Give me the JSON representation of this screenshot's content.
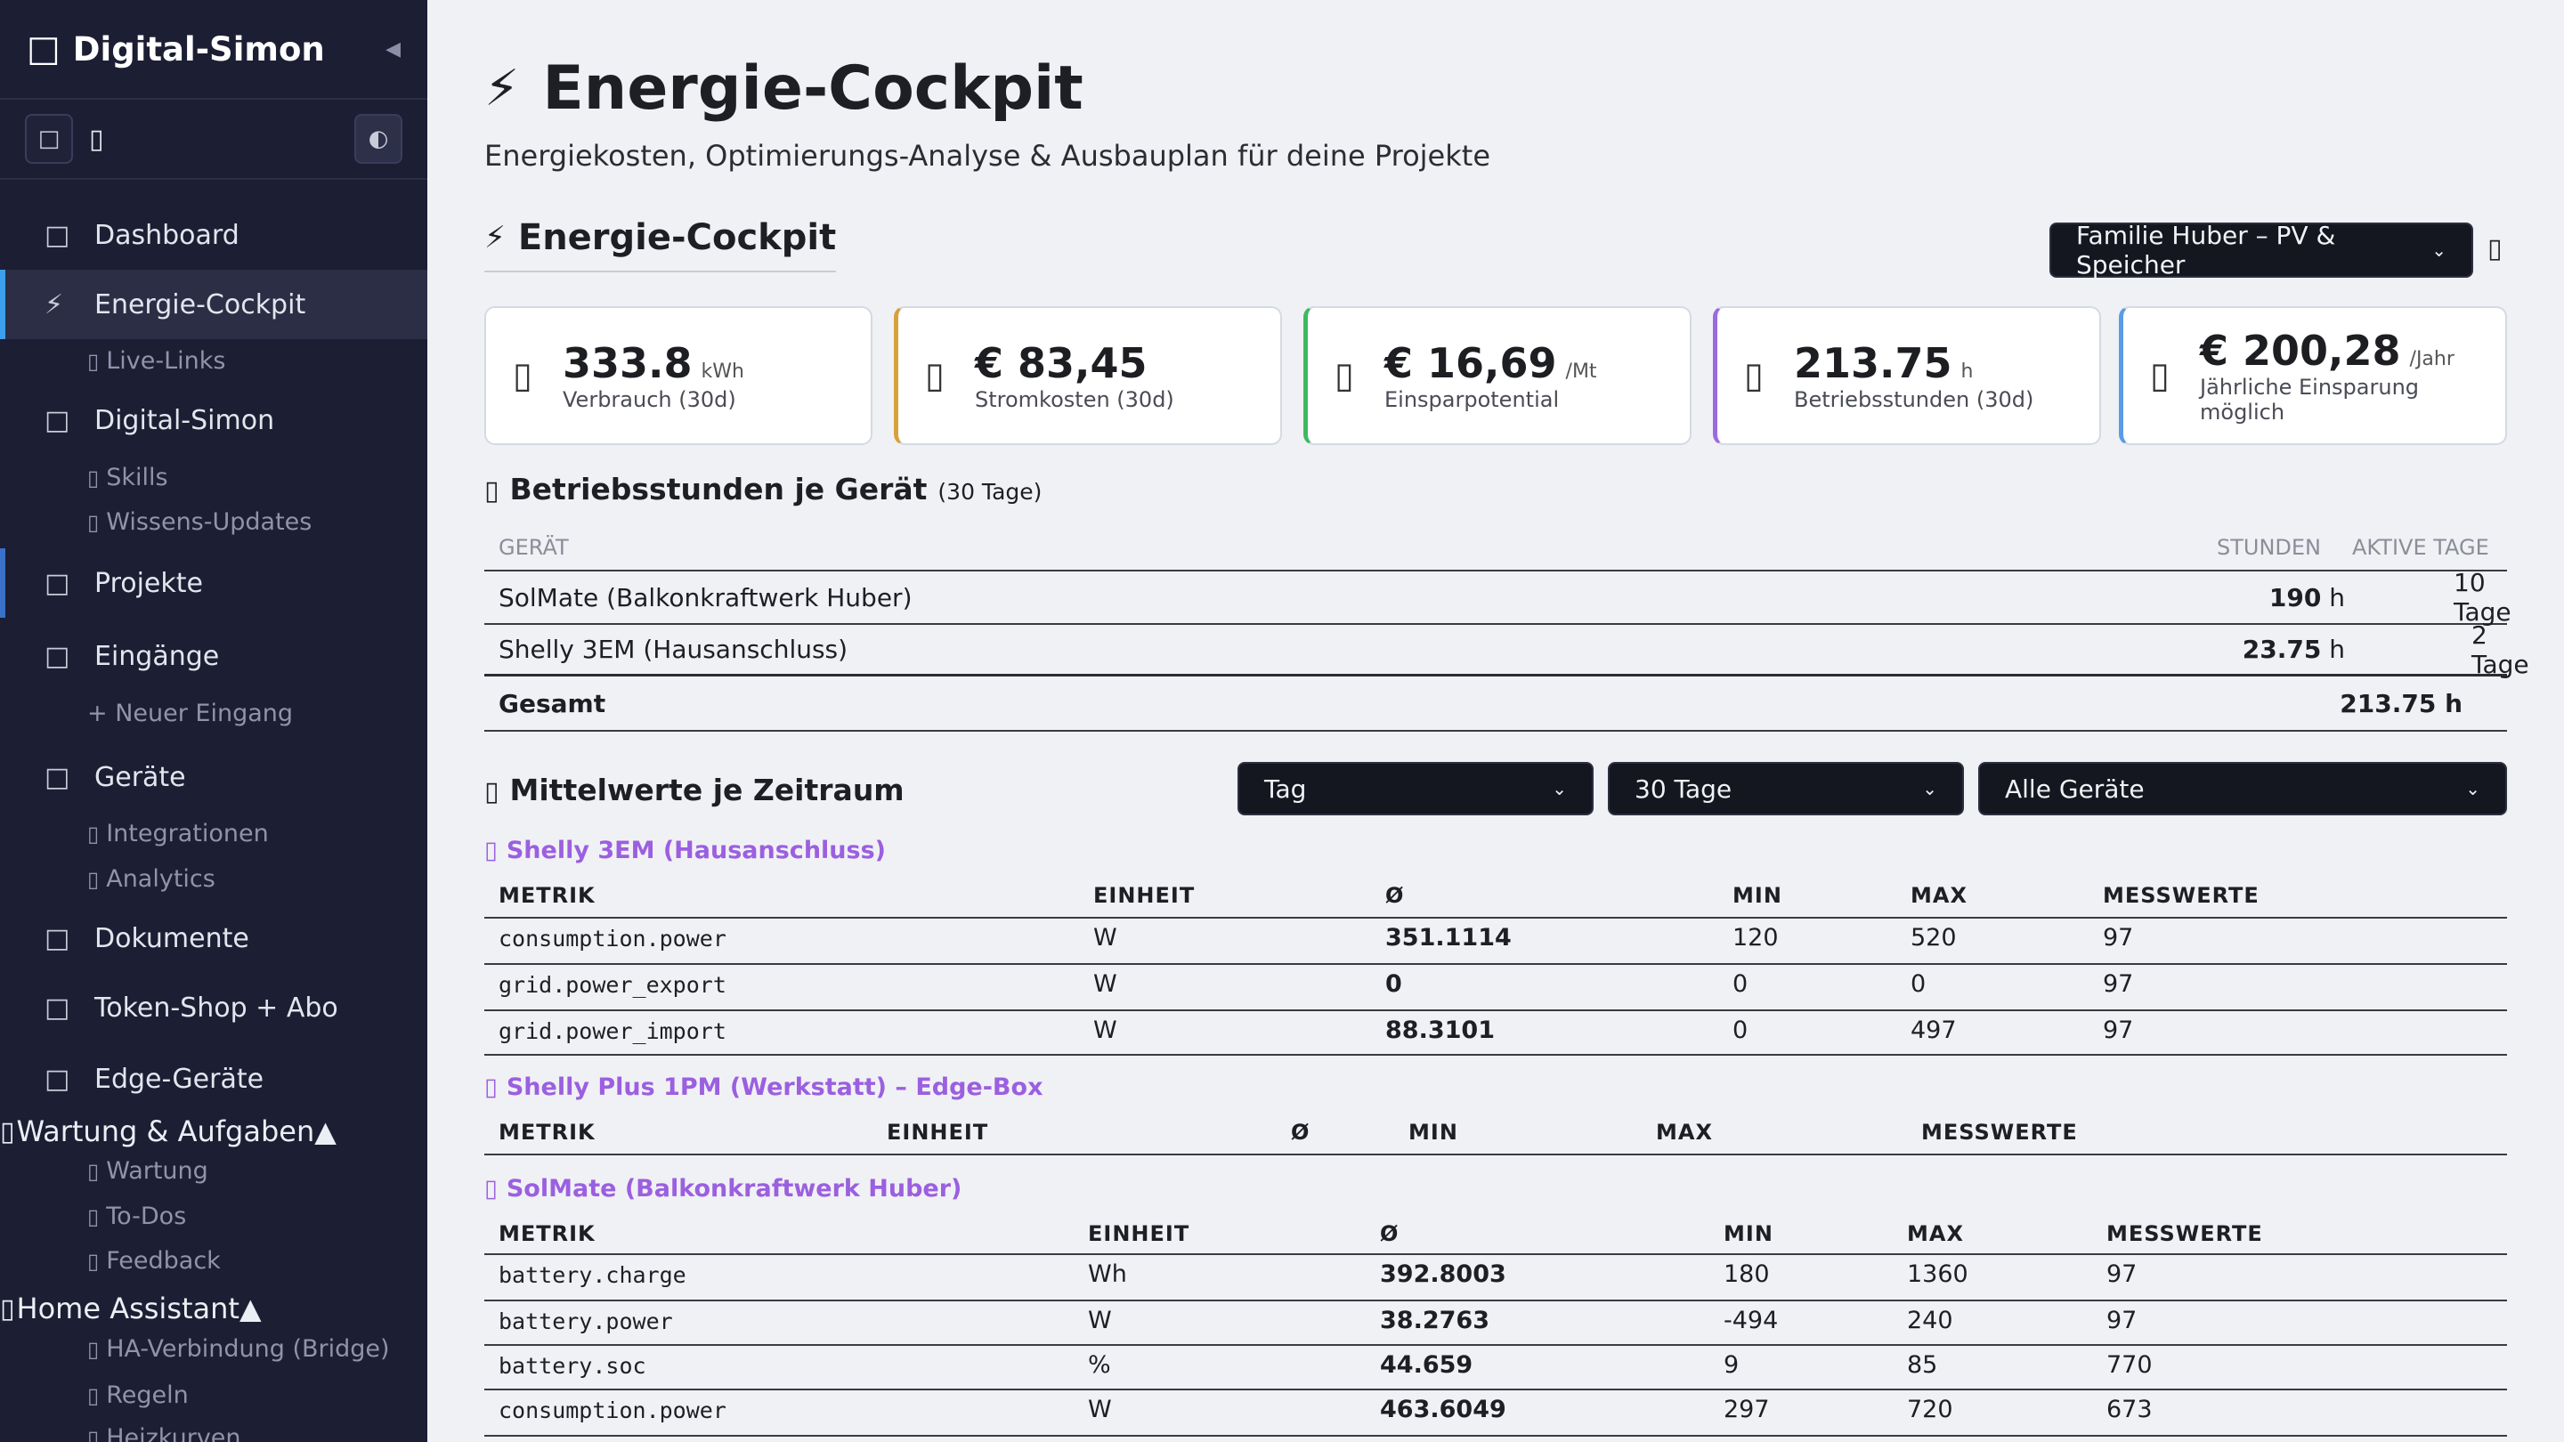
{
  "sidebar": {
    "brand_icon": "lightbulb-icon",
    "brand": "Digital-Simon",
    "collapse": "◀",
    "tool_icon_1": "home-icon",
    "tool_icon_2": "phone-icon",
    "tool_icon_3": "◐",
    "items": [
      {
        "icon": "",
        "label": "Dashboard"
      },
      {
        "icon": "⚡",
        "label": "Energie-Cockpit"
      },
      {
        "icon": "",
        "label": "Live-Links"
      },
      {
        "icon": "",
        "label": "Digital-Simon"
      },
      {
        "icon": "",
        "label": "Skills"
      },
      {
        "icon": "",
        "label": "Wissens-Updates"
      },
      {
        "icon": "",
        "label": "Projekte"
      },
      {
        "icon": "",
        "label": "Eingänge"
      },
      {
        "icon": "",
        "label": "+ Neuer Eingang"
      },
      {
        "icon": "",
        "label": "Geräte"
      },
      {
        "icon": "",
        "label": "Integrationen"
      },
      {
        "icon": "",
        "label": "Analytics"
      },
      {
        "icon": "",
        "label": "Dokumente"
      },
      {
        "icon": "",
        "label": "Token-Shop + Abo"
      },
      {
        "icon": "",
        "label": "Edge-Geräte"
      },
      {
        "icon": "",
        "label": "Wartung & Aufgaben▲"
      },
      {
        "icon": "",
        "label": "Wartung"
      },
      {
        "icon": "",
        "label": "To-Dos"
      },
      {
        "icon": "",
        "label": "Feedback"
      },
      {
        "icon": "",
        "label": "Home Assistant▲"
      },
      {
        "icon": "",
        "label": "HA-Verbindung (Bridge)"
      },
      {
        "icon": "",
        "label": "Regeln"
      },
      {
        "icon": "",
        "label": "Heizkurven"
      }
    ]
  },
  "header": {
    "title_icon": "⚡",
    "title": "Energie-Cockpit",
    "subtitle": "Energiekosten, Optimierungs-Analyse & Ausbauplan für deine Projekte"
  },
  "section": {
    "icon": "⚡",
    "title": "Energie-Cockpit",
    "project_select": "Familie Huber – PV & Speicher",
    "extra_button_icon": "phone-icon"
  },
  "kpis": [
    {
      "value": "333.8",
      "unit": "kWh",
      "label": "Verbrauch (30d)",
      "accent": "#d6d9e2"
    },
    {
      "value": "€ 83,45",
      "unit": "",
      "label": "Stromkosten (30d)",
      "accent": "#d6a23c"
    },
    {
      "value": "€ 16,69",
      "unit": "/Mt",
      "label": "Einsparpotential",
      "accent": "#3dba5f"
    },
    {
      "value": "213.75",
      "unit": "h",
      "label": "Betriebsstunden (30d)",
      "accent": "#9b6ae0"
    },
    {
      "value": "€ 200,28",
      "unit": "/Jahr",
      "label": "Jährliche Einsparung möglich",
      "accent": "#5a9be6"
    }
  ],
  "hours": {
    "title": "Betriebsstunden je Gerät",
    "period": "(30 Tage)",
    "columns": [
      "GERÄT",
      "STUNDEN",
      "AKTIVE TAGE"
    ],
    "rows": [
      {
        "device": "SolMate (Balkonkraftwerk Huber)",
        "hours": "190",
        "unit": "h",
        "days": "10 Tage"
      },
      {
        "device": "Shelly 3EM (Hausanschluss)",
        "hours": "23.75",
        "unit": "h",
        "days": "2 Tage"
      }
    ],
    "total_label": "Gesamt",
    "total_value": "213.75 h"
  },
  "averages": {
    "title": "Mittelwerte je Zeitraum",
    "select_interval": "Tag",
    "select_range": "30 Tage",
    "select_device": "Alle Geräte",
    "columns": [
      "METRIK",
      "EINHEIT",
      "Ø",
      "MIN",
      "MAX",
      "MESSWERTE"
    ],
    "devices": [
      {
        "title": "Shelly 3EM (Hausanschluss)",
        "rows": [
          [
            "consumption.power",
            "W",
            "351.1114",
            "120",
            "520",
            "97"
          ],
          [
            "grid.power_export",
            "W",
            "0",
            "0",
            "0",
            "97"
          ],
          [
            "grid.power_import",
            "W",
            "88.3101",
            "0",
            "497",
            "97"
          ]
        ]
      },
      {
        "title": "Shelly Plus 1PM (Werkstatt) – Edge-Box",
        "rows": []
      },
      {
        "title": "SolMate (Balkonkraftwerk Huber)",
        "rows": [
          [
            "battery.charge",
            "Wh",
            "392.8003",
            "180",
            "1360",
            "97"
          ],
          [
            "battery.power",
            "W",
            "38.2763",
            "-494",
            "240",
            "97"
          ],
          [
            "battery.soc",
            "%",
            "44.659",
            "9",
            "85",
            "770"
          ],
          [
            "consumption.power",
            "W",
            "463.6049",
            "297",
            "720",
            "673"
          ]
        ]
      }
    ]
  }
}
